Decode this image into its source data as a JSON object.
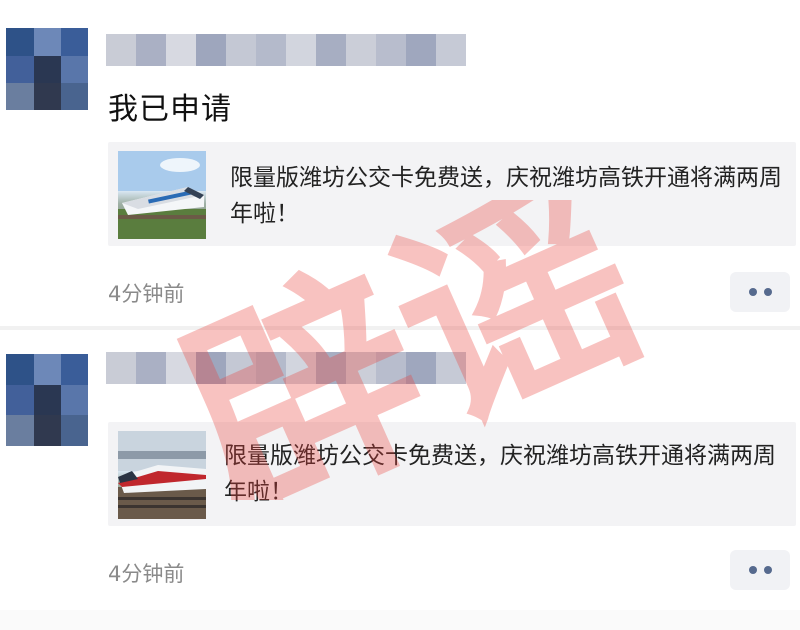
{
  "posts": [
    {
      "content": "我已申请",
      "link_card": {
        "title": "限量版潍坊公交卡免费送，庆祝潍坊高铁开通将满两周年啦！",
        "thumbnail_icon": "train-thumbnail"
      },
      "timestamp": "4分钟前"
    },
    {
      "content": "",
      "link_card": {
        "title": "限量版潍坊公交卡免费送，庆祝潍坊高铁开通将满两周年啦！",
        "thumbnail_icon": "train-thumbnail"
      },
      "timestamp": "4分钟前"
    }
  ],
  "stamp": {
    "text": "辟谣",
    "color": "#e8403a"
  },
  "colors": {
    "more_dots": "#566a8e",
    "timestamp": "#8a8a8a",
    "card_background": "#f3f3f5"
  }
}
